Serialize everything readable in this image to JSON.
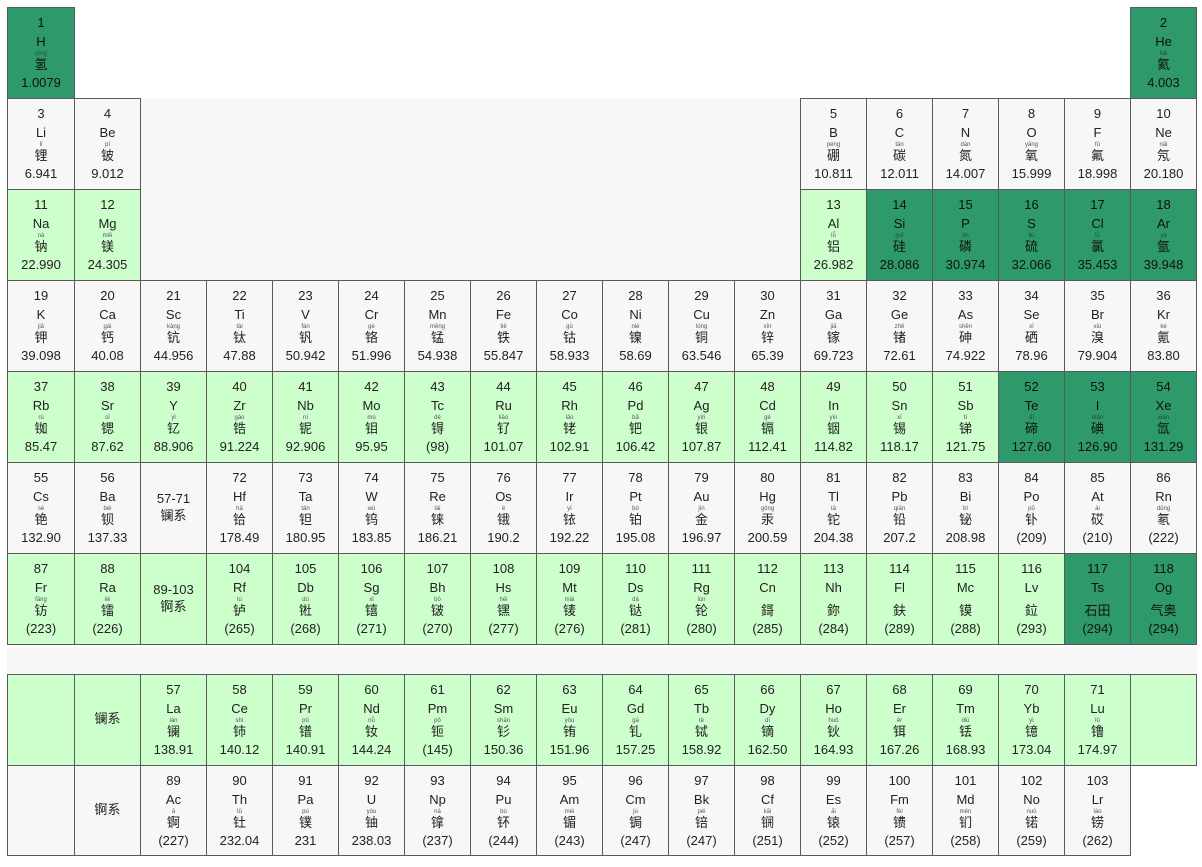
{
  "elements": [
    {
      "n": "1",
      "s": "H",
      "p": "qīng",
      "c": "氢",
      "m": "1.0079",
      "r": 0,
      "col": 0,
      "st": "d"
    },
    {
      "n": "2",
      "s": "He",
      "p": "hài",
      "c": "氦",
      "m": "4.003",
      "r": 0,
      "col": 17,
      "st": "d"
    },
    {
      "n": "3",
      "s": "Li",
      "p": "lǐ",
      "c": "锂",
      "m": "6.941",
      "r": 1,
      "col": 0,
      "st": "n"
    },
    {
      "n": "4",
      "s": "Be",
      "p": "pí",
      "c": "铍",
      "m": "9.012",
      "r": 1,
      "col": 1,
      "st": "n"
    },
    {
      "n": "5",
      "s": "B",
      "p": "péng",
      "c": "硼",
      "m": "10.811",
      "r": 1,
      "col": 12,
      "st": "n"
    },
    {
      "n": "6",
      "s": "C",
      "p": "tàn",
      "c": "碳",
      "m": "12.011",
      "r": 1,
      "col": 13,
      "st": "n"
    },
    {
      "n": "7",
      "s": "N",
      "p": "dàn",
      "c": "氮",
      "m": "14.007",
      "r": 1,
      "col": 14,
      "st": "n"
    },
    {
      "n": "8",
      "s": "O",
      "p": "yǎng",
      "c": "氧",
      "m": "15.999",
      "r": 1,
      "col": 15,
      "st": "n"
    },
    {
      "n": "9",
      "s": "F",
      "p": "fú",
      "c": "氟",
      "m": "18.998",
      "r": 1,
      "col": 16,
      "st": "n"
    },
    {
      "n": "10",
      "s": "Ne",
      "p": "nǎi",
      "c": "氖",
      "m": "20.180",
      "r": 1,
      "col": 17,
      "st": "n"
    },
    {
      "n": "11",
      "s": "Na",
      "p": "nà",
      "c": "钠",
      "m": "22.990",
      "r": 2,
      "col": 0,
      "st": "l"
    },
    {
      "n": "12",
      "s": "Mg",
      "p": "měi",
      "c": "镁",
      "m": "24.305",
      "r": 2,
      "col": 1,
      "st": "l"
    },
    {
      "n": "13",
      "s": "Al",
      "p": "lǚ",
      "c": "铝",
      "m": "26.982",
      "r": 2,
      "col": 12,
      "st": "l"
    },
    {
      "n": "14",
      "s": "Si",
      "p": "guī",
      "c": "硅",
      "m": "28.086",
      "r": 2,
      "col": 13,
      "st": "d"
    },
    {
      "n": "15",
      "s": "P",
      "p": "lín",
      "c": "磷",
      "m": "30.974",
      "r": 2,
      "col": 14,
      "st": "d"
    },
    {
      "n": "16",
      "s": "S",
      "p": "liú",
      "c": "硫",
      "m": "32.066",
      "r": 2,
      "col": 15,
      "st": "d"
    },
    {
      "n": "17",
      "s": "Cl",
      "p": "lǜ",
      "c": "氯",
      "m": "35.453",
      "r": 2,
      "col": 16,
      "st": "d"
    },
    {
      "n": "18",
      "s": "Ar",
      "p": "yà",
      "c": "氩",
      "m": "39.948",
      "r": 2,
      "col": 17,
      "st": "d"
    },
    {
      "n": "19",
      "s": "K",
      "p": "jiǎ",
      "c": "钾",
      "m": "39.098",
      "r": 3,
      "col": 0,
      "st": "n"
    },
    {
      "n": "20",
      "s": "Ca",
      "p": "gài",
      "c": "钙",
      "m": "40.08",
      "r": 3,
      "col": 1,
      "st": "n"
    },
    {
      "n": "21",
      "s": "Sc",
      "p": "kàng",
      "c": "钪",
      "m": "44.956",
      "r": 3,
      "col": 2,
      "st": "n"
    },
    {
      "n": "22",
      "s": "Ti",
      "p": "tài",
      "c": "钛",
      "m": "47.88",
      "r": 3,
      "col": 3,
      "st": "n"
    },
    {
      "n": "23",
      "s": "V",
      "p": "fán",
      "c": "钒",
      "m": "50.942",
      "r": 3,
      "col": 4,
      "st": "n"
    },
    {
      "n": "24",
      "s": "Cr",
      "p": "gè",
      "c": "铬",
      "m": "51.996",
      "r": 3,
      "col": 5,
      "st": "n"
    },
    {
      "n": "25",
      "s": "Mn",
      "p": "měng",
      "c": "锰",
      "m": "54.938",
      "r": 3,
      "col": 6,
      "st": "n"
    },
    {
      "n": "26",
      "s": "Fe",
      "p": "tiě",
      "c": "铁",
      "m": "55.847",
      "r": 3,
      "col": 7,
      "st": "n"
    },
    {
      "n": "27",
      "s": "Co",
      "p": "gǔ",
      "c": "钴",
      "m": "58.933",
      "r": 3,
      "col": 8,
      "st": "n"
    },
    {
      "n": "28",
      "s": "Ni",
      "p": "niè",
      "c": "镍",
      "m": "58.69",
      "r": 3,
      "col": 9,
      "st": "n"
    },
    {
      "n": "29",
      "s": "Cu",
      "p": "tóng",
      "c": "铜",
      "m": "63.546",
      "r": 3,
      "col": 10,
      "st": "n"
    },
    {
      "n": "30",
      "s": "Zn",
      "p": "xīn",
      "c": "锌",
      "m": "65.39",
      "r": 3,
      "col": 11,
      "st": "n"
    },
    {
      "n": "31",
      "s": "Ga",
      "p": "jiā",
      "c": "镓",
      "m": "69.723",
      "r": 3,
      "col": 12,
      "st": "n"
    },
    {
      "n": "32",
      "s": "Ge",
      "p": "zhě",
      "c": "锗",
      "m": "72.61",
      "r": 3,
      "col": 13,
      "st": "n"
    },
    {
      "n": "33",
      "s": "As",
      "p": "shēn",
      "c": "砷",
      "m": "74.922",
      "r": 3,
      "col": 14,
      "st": "n"
    },
    {
      "n": "34",
      "s": "Se",
      "p": "xī",
      "c": "硒",
      "m": "78.96",
      "r": 3,
      "col": 15,
      "st": "n"
    },
    {
      "n": "35",
      "s": "Br",
      "p": "xiù",
      "c": "溴",
      "m": "79.904",
      "r": 3,
      "col": 16,
      "st": "n"
    },
    {
      "n": "36",
      "s": "Kr",
      "p": "kè",
      "c": "氪",
      "m": "83.80",
      "r": 3,
      "col": 17,
      "st": "n"
    },
    {
      "n": "37",
      "s": "Rb",
      "p": "rú",
      "c": "铷",
      "m": "85.47",
      "r": 4,
      "col": 0,
      "st": "l"
    },
    {
      "n": "38",
      "s": "Sr",
      "p": "sī",
      "c": "锶",
      "m": "87.62",
      "r": 4,
      "col": 1,
      "st": "l"
    },
    {
      "n": "39",
      "s": "Y",
      "p": "yǐ",
      "c": "钇",
      "m": "88.906",
      "r": 4,
      "col": 2,
      "st": "l"
    },
    {
      "n": "40",
      "s": "Zr",
      "p": "gào",
      "c": "锆",
      "m": "91.224",
      "r": 4,
      "col": 3,
      "st": "l"
    },
    {
      "n": "41",
      "s": "Nb",
      "p": "ní",
      "c": "铌",
      "m": "92.906",
      "r": 4,
      "col": 4,
      "st": "l"
    },
    {
      "n": "42",
      "s": "Mo",
      "p": "mù",
      "c": "钼",
      "m": "95.95",
      "r": 4,
      "col": 5,
      "st": "l"
    },
    {
      "n": "43",
      "s": "Tc",
      "p": "dé",
      "c": "锝",
      "m": "(98)",
      "r": 4,
      "col": 6,
      "st": "l"
    },
    {
      "n": "44",
      "s": "Ru",
      "p": "liǎo",
      "c": "钌",
      "m": "101.07",
      "r": 4,
      "col": 7,
      "st": "l"
    },
    {
      "n": "45",
      "s": "Rh",
      "p": "lǎo",
      "c": "铑",
      "m": "102.91",
      "r": 4,
      "col": 8,
      "st": "l"
    },
    {
      "n": "46",
      "s": "Pd",
      "p": "bǎ",
      "c": "钯",
      "m": "106.42",
      "r": 4,
      "col": 9,
      "st": "l"
    },
    {
      "n": "47",
      "s": "Ag",
      "p": "yín",
      "c": "银",
      "m": "107.87",
      "r": 4,
      "col": 10,
      "st": "l"
    },
    {
      "n": "48",
      "s": "Cd",
      "p": "gé",
      "c": "镉",
      "m": "112.41",
      "r": 4,
      "col": 11,
      "st": "l"
    },
    {
      "n": "49",
      "s": "In",
      "p": "yīn",
      "c": "铟",
      "m": "114.82",
      "r": 4,
      "col": 12,
      "st": "l"
    },
    {
      "n": "50",
      "s": "Sn",
      "p": "xī",
      "c": "锡",
      "m": "118.17",
      "r": 4,
      "col": 13,
      "st": "l"
    },
    {
      "n": "51",
      "s": "Sb",
      "p": "tī",
      "c": "锑",
      "m": "121.75",
      "r": 4,
      "col": 14,
      "st": "l"
    },
    {
      "n": "52",
      "s": "Te",
      "p": "dì",
      "c": "碲",
      "m": "127.60",
      "r": 4,
      "col": 15,
      "st": "d"
    },
    {
      "n": "53",
      "s": "I",
      "p": "diǎn",
      "c": "碘",
      "m": "126.90",
      "r": 4,
      "col": 16,
      "st": "d"
    },
    {
      "n": "54",
      "s": "Xe",
      "p": "xiān",
      "c": "氙",
      "m": "131.29",
      "r": 4,
      "col": 17,
      "st": "d"
    },
    {
      "n": "55",
      "s": "Cs",
      "p": "sè",
      "c": "铯",
      "m": "132.90",
      "r": 5,
      "col": 0,
      "st": "n"
    },
    {
      "n": "56",
      "s": "Ba",
      "p": "bèi",
      "c": "钡",
      "m": "137.33",
      "r": 5,
      "col": 1,
      "st": "n"
    },
    {
      "n": "72",
      "s": "Hf",
      "p": "hā",
      "c": "铪",
      "m": "178.49",
      "r": 5,
      "col": 3,
      "st": "n"
    },
    {
      "n": "73",
      "s": "Ta",
      "p": "tǎn",
      "c": "钽",
      "m": "180.95",
      "r": 5,
      "col": 4,
      "st": "n"
    },
    {
      "n": "74",
      "s": "W",
      "p": "wū",
      "c": "钨",
      "m": "183.85",
      "r": 5,
      "col": 5,
      "st": "n"
    },
    {
      "n": "75",
      "s": "Re",
      "p": "lái",
      "c": "铼",
      "m": "186.21",
      "r": 5,
      "col": 6,
      "st": "n"
    },
    {
      "n": "76",
      "s": "Os",
      "p": "é",
      "c": "锇",
      "m": "190.2",
      "r": 5,
      "col": 7,
      "st": "n"
    },
    {
      "n": "77",
      "s": "Ir",
      "p": "yī",
      "c": "铱",
      "m": "192.22",
      "r": 5,
      "col": 8,
      "st": "n"
    },
    {
      "n": "78",
      "s": "Pt",
      "p": "bó",
      "c": "铂",
      "m": "195.08",
      "r": 5,
      "col": 9,
      "st": "n"
    },
    {
      "n": "79",
      "s": "Au",
      "p": "jīn",
      "c": "金",
      "m": "196.97",
      "r": 5,
      "col": 10,
      "st": "n"
    },
    {
      "n": "80",
      "s": "Hg",
      "p": "gǒng",
      "c": "汞",
      "m": "200.59",
      "r": 5,
      "col": 11,
      "st": "n"
    },
    {
      "n": "81",
      "s": "Tl",
      "p": "tā",
      "c": "铊",
      "m": "204.38",
      "r": 5,
      "col": 12,
      "st": "n"
    },
    {
      "n": "82",
      "s": "Pb",
      "p": "qiān",
      "c": "铅",
      "m": "207.2",
      "r": 5,
      "col": 13,
      "st": "n"
    },
    {
      "n": "83",
      "s": "Bi",
      "p": "bì",
      "c": "铋",
      "m": "208.98",
      "r": 5,
      "col": 14,
      "st": "n"
    },
    {
      "n": "84",
      "s": "Po",
      "p": "pō",
      "c": "钋",
      "m": "(209)",
      "r": 5,
      "col": 15,
      "st": "n"
    },
    {
      "n": "85",
      "s": "At",
      "p": "ài",
      "c": "砹",
      "m": "(210)",
      "r": 5,
      "col": 16,
      "st": "n"
    },
    {
      "n": "86",
      "s": "Rn",
      "p": "dōng",
      "c": "氡",
      "m": "(222)",
      "r": 5,
      "col": 17,
      "st": "n"
    },
    {
      "n": "87",
      "s": "Fr",
      "p": "fāng",
      "c": "钫",
      "m": "(223)",
      "r": 6,
      "col": 0,
      "st": "l"
    },
    {
      "n": "88",
      "s": "Ra",
      "p": "léi",
      "c": "镭",
      "m": "(226)",
      "r": 6,
      "col": 1,
      "st": "l"
    },
    {
      "n": "104",
      "s": "Rf",
      "p": "lú",
      "c": "𬬻",
      "m": "(265)",
      "r": 6,
      "col": 3,
      "st": "l"
    },
    {
      "n": "105",
      "s": "Db",
      "p": "dù",
      "c": "𬭊",
      "m": "(268)",
      "r": 6,
      "col": 4,
      "st": "l"
    },
    {
      "n": "106",
      "s": "Sg",
      "p": "xǐ",
      "c": "𬭳",
      "m": "(271)",
      "r": 6,
      "col": 5,
      "st": "l"
    },
    {
      "n": "107",
      "s": "Bh",
      "p": "bō",
      "c": "𬭛",
      "m": "(270)",
      "r": 6,
      "col": 6,
      "st": "l"
    },
    {
      "n": "108",
      "s": "Hs",
      "p": "hēi",
      "c": "𬭶",
      "m": "(277)",
      "r": 6,
      "col": 7,
      "st": "l"
    },
    {
      "n": "109",
      "s": "Mt",
      "p": "mài",
      "c": "鿏",
      "m": "(276)",
      "r": 6,
      "col": 8,
      "st": "l"
    },
    {
      "n": "110",
      "s": "Ds",
      "p": "dá",
      "c": "𫟼",
      "m": "(281)",
      "r": 6,
      "col": 9,
      "st": "l"
    },
    {
      "n": "111",
      "s": "Rg",
      "p": "lún",
      "c": "𬬭",
      "m": "(280)",
      "r": 6,
      "col": 10,
      "st": "l"
    },
    {
      "n": "112",
      "s": "Cn",
      "p": "",
      "c": "鎶",
      "m": "(285)",
      "r": 6,
      "col": 11,
      "st": "l"
    },
    {
      "n": "113",
      "s": "Nh",
      "p": "",
      "c": "鉨",
      "m": "(284)",
      "r": 6,
      "col": 12,
      "st": "l"
    },
    {
      "n": "114",
      "s": "Fl",
      "p": "",
      "c": "鈇",
      "m": "(289)",
      "r": 6,
      "col": 13,
      "st": "l"
    },
    {
      "n": "115",
      "s": "Mc",
      "p": "",
      "c": "镆",
      "m": "(288)",
      "r": 6,
      "col": 14,
      "st": "l"
    },
    {
      "n": "116",
      "s": "Lv",
      "p": "",
      "c": "鉝",
      "m": "(293)",
      "r": 6,
      "col": 15,
      "st": "l"
    },
    {
      "n": "117",
      "s": "Ts",
      "p": "",
      "c": "石田",
      "m": "(294)",
      "r": 6,
      "col": 16,
      "st": "d"
    },
    {
      "n": "118",
      "s": "Og",
      "p": "",
      "c": "气奥",
      "m": "(294)",
      "r": 6,
      "col": 17,
      "st": "d"
    },
    {
      "n": "57",
      "s": "La",
      "p": "lán",
      "c": "镧",
      "m": "138.91",
      "r": 7,
      "col": 2,
      "st": "l"
    },
    {
      "n": "58",
      "s": "Ce",
      "p": "shì",
      "c": "铈",
      "m": "140.12",
      "r": 7,
      "col": 3,
      "st": "l"
    },
    {
      "n": "59",
      "s": "Pr",
      "p": "pǔ",
      "c": "镨",
      "m": "140.91",
      "r": 7,
      "col": 4,
      "st": "l"
    },
    {
      "n": "60",
      "s": "Nd",
      "p": "nǚ",
      "c": "钕",
      "m": "144.24",
      "r": 7,
      "col": 5,
      "st": "l"
    },
    {
      "n": "61",
      "s": "Pm",
      "p": "pǒ",
      "c": "钷",
      "m": "(145)",
      "r": 7,
      "col": 6,
      "st": "l"
    },
    {
      "n": "62",
      "s": "Sm",
      "p": "shān",
      "c": "钐",
      "m": "150.36",
      "r": 7,
      "col": 7,
      "st": "l"
    },
    {
      "n": "63",
      "s": "Eu",
      "p": "yǒu",
      "c": "铕",
      "m": "151.96",
      "r": 7,
      "col": 8,
      "st": "l"
    },
    {
      "n": "64",
      "s": "Gd",
      "p": "gá",
      "c": "钆",
      "m": "157.25",
      "r": 7,
      "col": 9,
      "st": "l"
    },
    {
      "n": "65",
      "s": "Tb",
      "p": "tè",
      "c": "铽",
      "m": "158.92",
      "r": 7,
      "col": 10,
      "st": "l"
    },
    {
      "n": "66",
      "s": "Dy",
      "p": "dī",
      "c": "镝",
      "m": "162.50",
      "r": 7,
      "col": 11,
      "st": "l"
    },
    {
      "n": "67",
      "s": "Ho",
      "p": "huǒ",
      "c": "钬",
      "m": "164.93",
      "r": 7,
      "col": 12,
      "st": "l"
    },
    {
      "n": "68",
      "s": "Er",
      "p": "ěr",
      "c": "铒",
      "m": "167.26",
      "r": 7,
      "col": 13,
      "st": "l"
    },
    {
      "n": "69",
      "s": "Tm",
      "p": "diū",
      "c": "铥",
      "m": "168.93",
      "r": 7,
      "col": 14,
      "st": "l"
    },
    {
      "n": "70",
      "s": "Yb",
      "p": "yì",
      "c": "镱",
      "m": "173.04",
      "r": 7,
      "col": 15,
      "st": "l"
    },
    {
      "n": "71",
      "s": "Lu",
      "p": "lǔ",
      "c": "镥",
      "m": "174.97",
      "r": 7,
      "col": 16,
      "st": "l"
    },
    {
      "n": "89",
      "s": "Ac",
      "p": "ā",
      "c": "锕",
      "m": "(227)",
      "r": 8,
      "col": 2,
      "st": "n"
    },
    {
      "n": "90",
      "s": "Th",
      "p": "tǔ",
      "c": "钍",
      "m": "232.04",
      "r": 8,
      "col": 3,
      "st": "n"
    },
    {
      "n": "91",
      "s": "Pa",
      "p": "pú",
      "c": "镤",
      "m": "231",
      "r": 8,
      "col": 4,
      "st": "n"
    },
    {
      "n": "92",
      "s": "U",
      "p": "yóu",
      "c": "铀",
      "m": "238.03",
      "r": 8,
      "col": 5,
      "st": "n"
    },
    {
      "n": "93",
      "s": "Np",
      "p": "ná",
      "c": "镎",
      "m": "(237)",
      "r": 8,
      "col": 6,
      "st": "n"
    },
    {
      "n": "94",
      "s": "Pu",
      "p": "bù",
      "c": "钚",
      "m": "(244)",
      "r": 8,
      "col": 7,
      "st": "n"
    },
    {
      "n": "95",
      "s": "Am",
      "p": "méi",
      "c": "镅",
      "m": "(243)",
      "r": 8,
      "col": 8,
      "st": "n"
    },
    {
      "n": "96",
      "s": "Cm",
      "p": "jú",
      "c": "锔",
      "m": "(247)",
      "r": 8,
      "col": 9,
      "st": "n"
    },
    {
      "n": "97",
      "s": "Bk",
      "p": "péi",
      "c": "锫",
      "m": "(247)",
      "r": 8,
      "col": 10,
      "st": "n"
    },
    {
      "n": "98",
      "s": "Cf",
      "p": "kāi",
      "c": "锎",
      "m": "(251)",
      "r": 8,
      "col": 11,
      "st": "n"
    },
    {
      "n": "99",
      "s": "Es",
      "p": "āi",
      "c": "锿",
      "m": "(252)",
      "r": 8,
      "col": 12,
      "st": "n"
    },
    {
      "n": "100",
      "s": "Fm",
      "p": "fèi",
      "c": "镄",
      "m": "(257)",
      "r": 8,
      "col": 13,
      "st": "n"
    },
    {
      "n": "101",
      "s": "Md",
      "p": "mén",
      "c": "钔",
      "m": "(258)",
      "r": 8,
      "col": 14,
      "st": "n"
    },
    {
      "n": "102",
      "s": "No",
      "p": "nuò",
      "c": "锘",
      "m": "(259)",
      "r": 8,
      "col": 15,
      "st": "n"
    },
    {
      "n": "103",
      "s": "Lr",
      "p": "láo",
      "c": "铹",
      "m": "(262)",
      "r": 8,
      "col": 16,
      "st": "n"
    }
  ],
  "series_refs": [
    {
      "range": "57-71",
      "name": "镧系",
      "r": 5,
      "col": 2,
      "st": "n"
    },
    {
      "range": "89-103",
      "name": "锕系",
      "r": 6,
      "col": 2,
      "st": "l"
    }
  ],
  "series_rows": [
    {
      "name": "镧系",
      "r": 7,
      "st": "l"
    },
    {
      "name": "锕系",
      "r": 8,
      "st": "n"
    }
  ],
  "colors": {
    "normal": "#f7f7f7",
    "light_green": "#ccffcc",
    "dark_green": "#2e9a6c",
    "border": "#5a5a5a"
  }
}
